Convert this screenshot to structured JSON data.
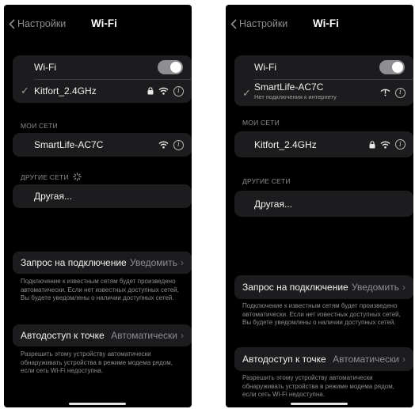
{
  "left": {
    "back_label": "Настройки",
    "title": "Wi-Fi",
    "wifi_label": "Wi-Fi",
    "connected_network": "Kitfort_2.4GHz",
    "my_networks_header": "МОИ СЕТИ",
    "my_network": "SmartLife-AC7C",
    "other_networks_header": "ДРУГИЕ СЕТИ",
    "other_label": "Другая...",
    "ask_join_label": "Запрос на подключение",
    "ask_join_value": "Уведомить",
    "ask_join_note": "Подключение к известным сетям будет произведено автоматически. Если нет известных доступных сетей, Вы будете уведомлены о наличии доступных сетей.",
    "hotspot_label": "Автодоступ к точке",
    "hotspot_value": "Автоматически",
    "hotspot_note": "Разрешить этому устройству автоматически обнаруживать устройства в режиме модема рядом, если сеть Wi-Fi недоступна."
  },
  "right": {
    "back_label": "Настройки",
    "title": "Wi-Fi",
    "wifi_label": "Wi-Fi",
    "connected_network": "SmartLife-AC7C",
    "connected_status": "Нет подключения к интернету",
    "my_networks_header": "МОИ СЕТИ",
    "my_network": "Kitfort_2.4GHz",
    "other_networks_header": "ДРУГИЕ СЕТИ",
    "other_label": "Другая...",
    "ask_join_label": "Запрос на подключение",
    "ask_join_value": "Уведомить",
    "ask_join_note": "Подключение к известным сетям будет произведено автоматически. Если нет известных доступных сетей, Вы будете уведомлены о наличии доступных сетей.",
    "hotspot_label": "Автодоступ к точке",
    "hotspot_value": "Автоматически",
    "hotspot_note": "Разрешить этому устройству автоматически обнаруживать устройства в режиме модема рядом, если сеть Wi-Fi недоступна."
  },
  "icons": {
    "info": "i",
    "chevron": "›",
    "check": "✓"
  },
  "colors": {
    "background": "#000000",
    "cell": "#1c1c1e",
    "secondary_text": "#8e8e93",
    "toggle_on": "#8e8e93"
  }
}
